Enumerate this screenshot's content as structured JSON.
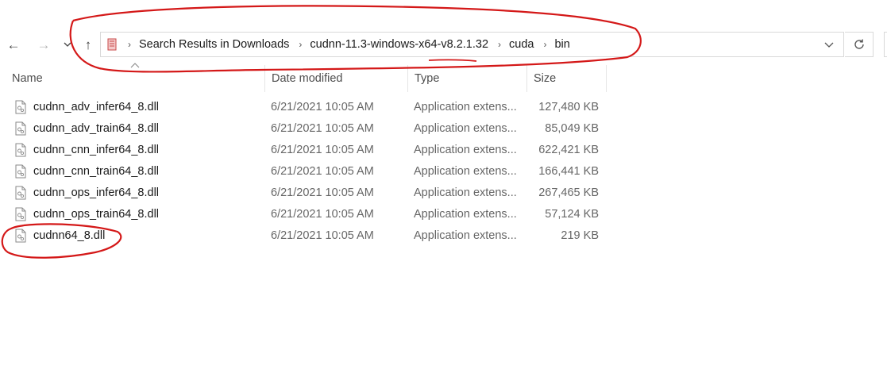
{
  "nav": {
    "back_glyph": "←",
    "forward_glyph": "→",
    "recent_glyph": "⌄",
    "up_glyph": "↑"
  },
  "address": {
    "crumbs": [
      "Search Results in Downloads",
      "cudnn-11.3-windows-x64-v8.2.1.32",
      "cuda",
      "bin"
    ],
    "separator": "›"
  },
  "columns": {
    "name": "Name",
    "date": "Date modified",
    "type": "Type",
    "size": "Size"
  },
  "files": [
    {
      "name": "cudnn_adv_infer64_8.dll",
      "date": "6/21/2021 10:05 AM",
      "type": "Application extens...",
      "size": "127,480 KB"
    },
    {
      "name": "cudnn_adv_train64_8.dll",
      "date": "6/21/2021 10:05 AM",
      "type": "Application extens...",
      "size": "85,049 KB"
    },
    {
      "name": "cudnn_cnn_infer64_8.dll",
      "date": "6/21/2021 10:05 AM",
      "type": "Application extens...",
      "size": "622,421 KB"
    },
    {
      "name": "cudnn_cnn_train64_8.dll",
      "date": "6/21/2021 10:05 AM",
      "type": "Application extens...",
      "size": "166,441 KB"
    },
    {
      "name": "cudnn_ops_infer64_8.dll",
      "date": "6/21/2021 10:05 AM",
      "type": "Application extens...",
      "size": "267,465 KB"
    },
    {
      "name": "cudnn_ops_train64_8.dll",
      "date": "6/21/2021 10:05 AM",
      "type": "Application extens...",
      "size": "57,124 KB"
    },
    {
      "name": "cudnn64_8.dll",
      "date": "6/21/2021 10:05 AM",
      "type": "Application extens...",
      "size": "219 KB"
    }
  ],
  "colors": {
    "annotation": "#d41818",
    "text": "#1a1a1a",
    "secondary_text": "#666666",
    "border": "#d9d9d9"
  }
}
